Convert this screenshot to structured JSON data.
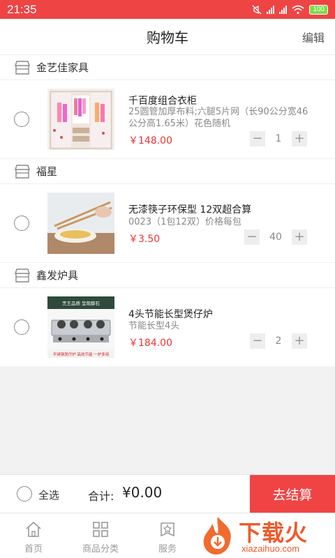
{
  "status_bar": {
    "time": "21:35",
    "battery": "100"
  },
  "header": {
    "title": "购物车",
    "edit_label": "编辑"
  },
  "shops": [
    {
      "name": "金艺佳家具",
      "item": {
        "name": "千百度组合衣柜",
        "desc": "25圆管加厚布料;六腿5片网（长90公分宽46公分高1.65米）花色随机",
        "price": "￥148.00",
        "quantity": "1"
      }
    },
    {
      "name": "福星",
      "item": {
        "name": "无漆筷子环保型  12双超合算",
        "desc": "0023（1包12双）价格每包",
        "price": "￥3.50",
        "quantity": "40"
      }
    },
    {
      "name": "鑫发炉具",
      "item": {
        "name": "4头节能长型煲仔炉",
        "desc": "节能长型4头",
        "price": "￥184.00",
        "quantity": "2"
      }
    }
  ],
  "stove_image_text": {
    "top": "烹王品质 呈现醇石",
    "bottom": "不锈钢煲仔炉  高效节能  一炉多用"
  },
  "footer": {
    "select_all": "全选",
    "total_label": "合计:",
    "total_value": "¥0.00",
    "checkout_label": "去结算"
  },
  "tabs": [
    {
      "label": "首页",
      "icon": "home-icon"
    },
    {
      "label": "商品分类",
      "icon": "category-icon"
    },
    {
      "label": "服务",
      "icon": "service-icon"
    }
  ],
  "watermark": {
    "brand": "下载火",
    "url": "xiazaihuo.com"
  },
  "colors": {
    "accent": "#ee4444",
    "price": "#e33333"
  }
}
